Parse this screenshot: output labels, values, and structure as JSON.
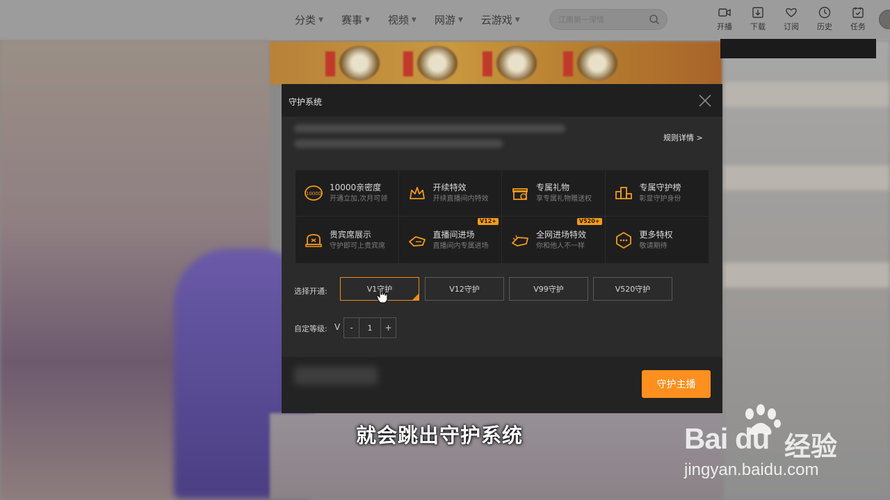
{
  "nav": {
    "menu": [
      {
        "label": "分类"
      },
      {
        "label": "赛事"
      },
      {
        "label": "视频"
      },
      {
        "label": "网游"
      },
      {
        "label": "云游戏"
      }
    ],
    "search_placeholder": "江南第一深情",
    "tools": [
      {
        "label": "开播",
        "icon": "video-camera-icon"
      },
      {
        "label": "下载",
        "icon": "download-icon"
      },
      {
        "label": "订阅",
        "icon": "heart-icon"
      },
      {
        "label": "历史",
        "icon": "clock-icon"
      },
      {
        "label": "任务",
        "icon": "calendar-check-icon"
      }
    ]
  },
  "modal": {
    "title": "守护系统",
    "rules_link": "规则详情 >",
    "privileges": [
      {
        "title": "10000亲密度",
        "sub": "开通立加,次月可领",
        "icon": "intimacy-coin-icon",
        "badge": ""
      },
      {
        "title": "开续特效",
        "sub": "开续直播间内特效",
        "icon": "crown-effect-icon",
        "badge": ""
      },
      {
        "title": "专属礼物",
        "sub": "享专属礼物赠送权",
        "icon": "gift-icon",
        "badge": ""
      },
      {
        "title": "专属守护榜",
        "sub": "彰显守护身份",
        "icon": "podium-icon",
        "badge": ""
      },
      {
        "title": "贵宾席展示",
        "sub": "守护即可上贵宾席",
        "icon": "vip-seat-icon",
        "badge": ""
      },
      {
        "title": "直播间进场",
        "sub": "直播间内专属进场",
        "icon": "entrance-icon",
        "badge": "V12+"
      },
      {
        "title": "全网进场特效",
        "sub": "你和他人不一样",
        "icon": "global-entrance-icon",
        "badge": "V520+"
      },
      {
        "title": "更多特权",
        "sub": "敬请期待",
        "icon": "more-privileges-icon",
        "badge": ""
      }
    ],
    "select_label": "选择开通:",
    "levels": [
      {
        "label": "V1守护",
        "selected": true
      },
      {
        "label": "V12守护",
        "selected": false
      },
      {
        "label": "V99守护",
        "selected": false
      },
      {
        "label": "V520守护",
        "selected": false
      }
    ],
    "custom_label": "自定等级:",
    "level_prefix": "V",
    "stepper": {
      "minus": "-",
      "value": "1",
      "plus": "+"
    },
    "guard_button": "守护主播"
  },
  "subtitle": "就会跳出守护系统",
  "watermark": {
    "brand": "Bai du",
    "cn": "经验",
    "url": "jingyan.baidu.com"
  },
  "colors": {
    "accent": "#ff8f1f",
    "selected_border": "#f08c1a",
    "modal_bg": "#2b2b2b",
    "header_bg": "#1f1f1f"
  }
}
